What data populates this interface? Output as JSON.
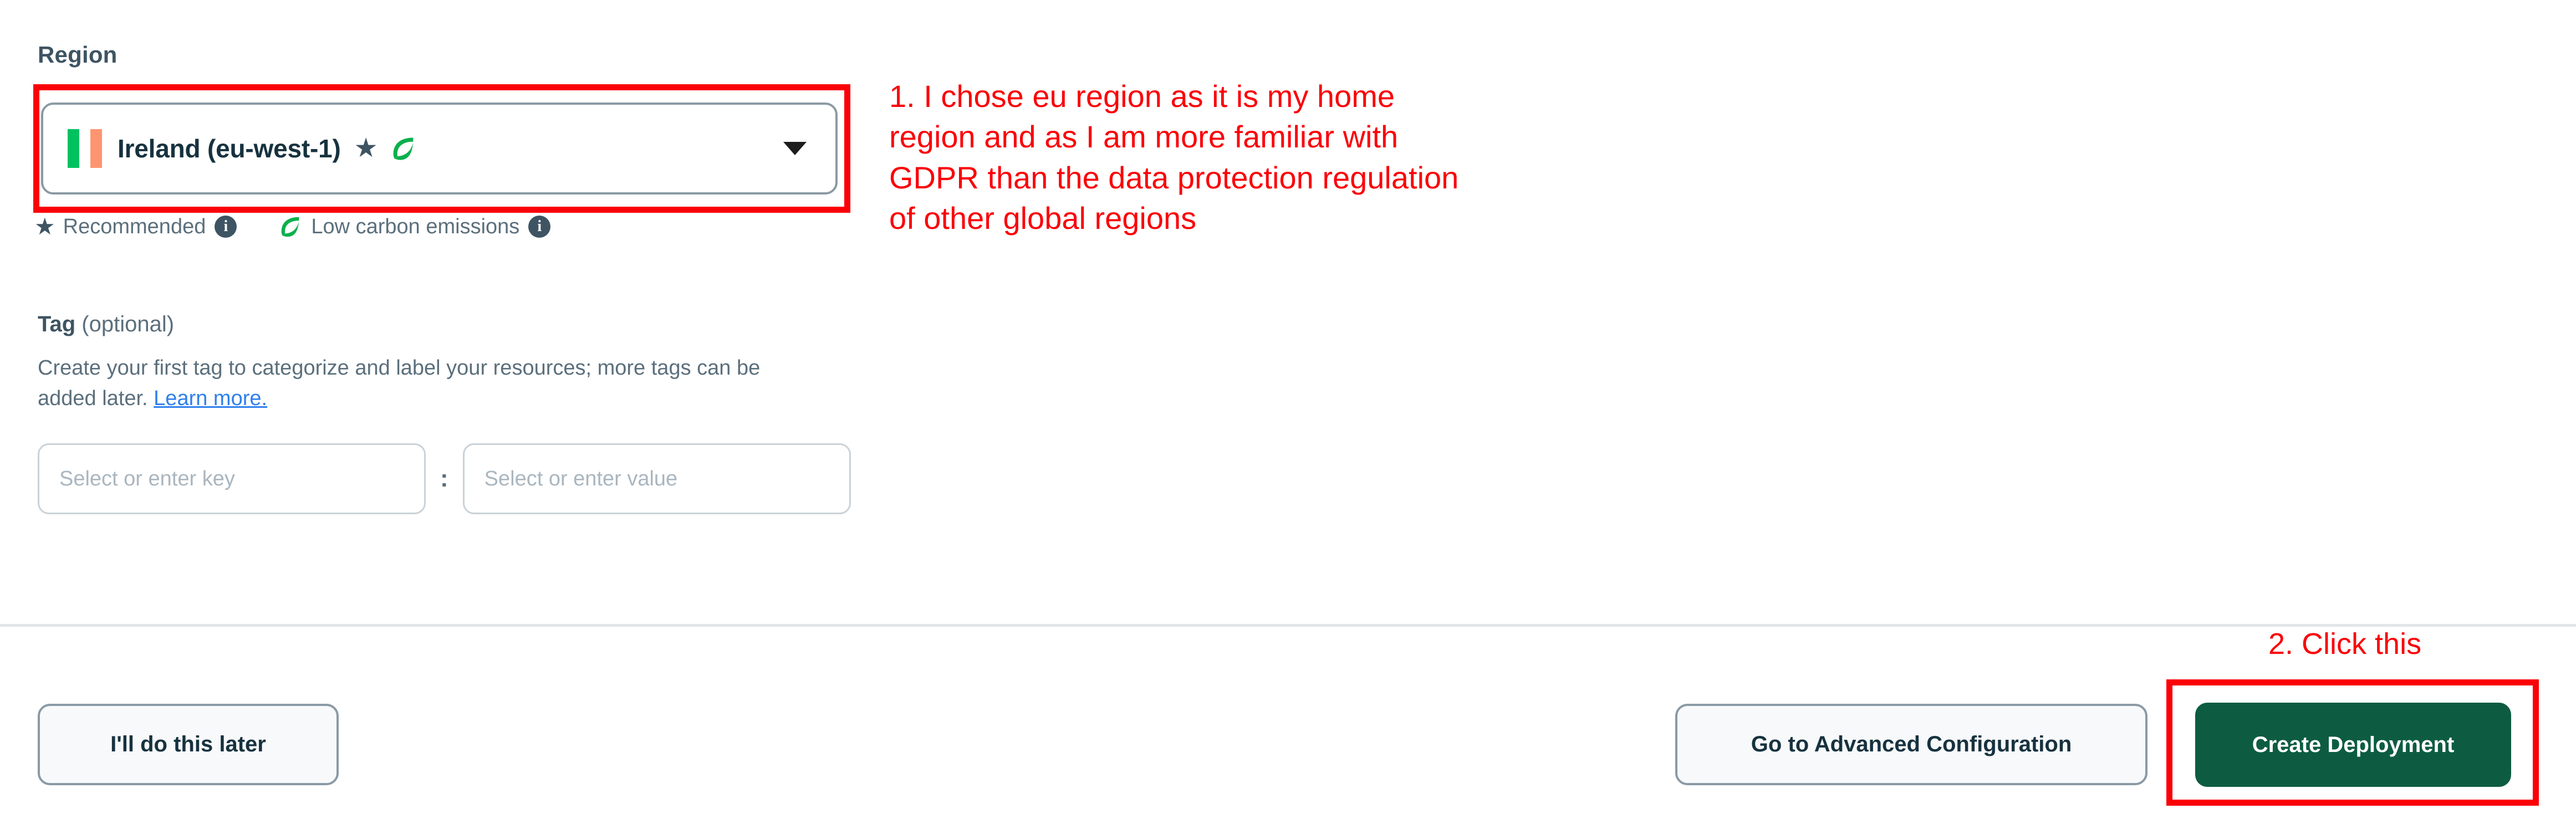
{
  "region": {
    "label": "Region",
    "selected_value": "Ireland (eu-west-1)",
    "flag_icon": "ireland-flag-icon",
    "recommended_badge_icon": "star-icon",
    "low_carbon_badge_icon": "leaf-icon",
    "caret_icon": "chevron-down-icon",
    "legend": [
      {
        "icon": "star-icon",
        "label": "Recommended",
        "info_icon": "info-icon",
        "info_glyph": "i"
      },
      {
        "icon": "leaf-icon",
        "label": "Low carbon emissions",
        "info_icon": "info-icon",
        "info_glyph": "i"
      }
    ]
  },
  "tag": {
    "title_bold": "Tag",
    "title_rest": " (optional)",
    "description": "Create your first tag to categorize and label your resources; more tags can be added later. ",
    "learn_more": "Learn more.",
    "key_placeholder": "Select or enter key",
    "value_placeholder": "Select or enter value",
    "separator": ":"
  },
  "annotations": {
    "note_1": "1. I chose eu region as it is my home\nregion and as I am more familiar with\nGDPR than the data protection regulation\nof other global regions",
    "note_2": "2. Click this",
    "color": "#fb0007"
  },
  "footer": {
    "later_label": "I'll do this later",
    "advanced_label": "Go to Advanced Configuration",
    "create_label": "Create Deployment",
    "create_color": "#0d5c42"
  }
}
